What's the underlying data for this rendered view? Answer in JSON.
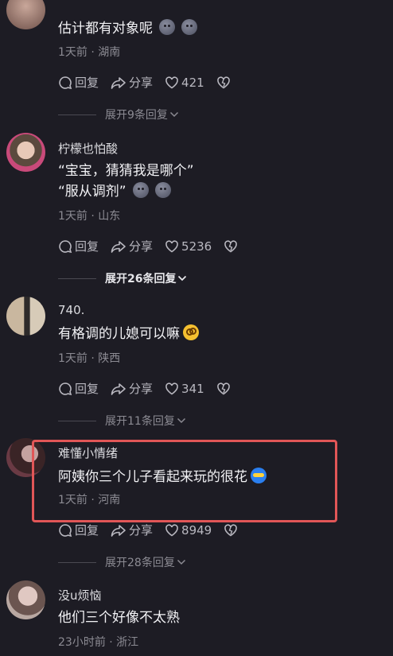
{
  "comments": [
    {
      "text": "估计都有对象呢",
      "meta": "1天前 · 湖南",
      "reply_label": "回复",
      "share_label": "分享",
      "likes": "421",
      "expand_label": "展开9条回复"
    },
    {
      "name": "柠檬也怕酸",
      "text_line1": "“宝宝，猜猜我是哪个”",
      "text_line2": "“服从调剂”",
      "meta": "1天前 · 山东",
      "reply_label": "回复",
      "share_label": "分享",
      "likes": "5236",
      "expand_label": "展开26条回复"
    },
    {
      "name": "740.",
      "text": "有格调的儿媳可以嘛",
      "meta": "1天前 · 陕西",
      "reply_label": "回复",
      "share_label": "分享",
      "likes": "341",
      "expand_label": "展开11条回复"
    },
    {
      "name": "难懂小情绪",
      "text": "阿姨你三个儿子看起来玩的很花",
      "meta": "1天前 · 河南",
      "reply_label": "回复",
      "share_label": "分享",
      "likes": "8949",
      "expand_label": "展开28条回复"
    },
    {
      "name": "没u烦恼",
      "text": "他们三个好像不太熟",
      "meta": "23小时前 · 浙江"
    }
  ],
  "colors": {
    "highlight": "#e15657",
    "background": "#1d1c24"
  },
  "icons": [
    "comment-icon",
    "share-icon",
    "heart-icon",
    "dislike-heart-icon",
    "chevron-down-icon"
  ]
}
